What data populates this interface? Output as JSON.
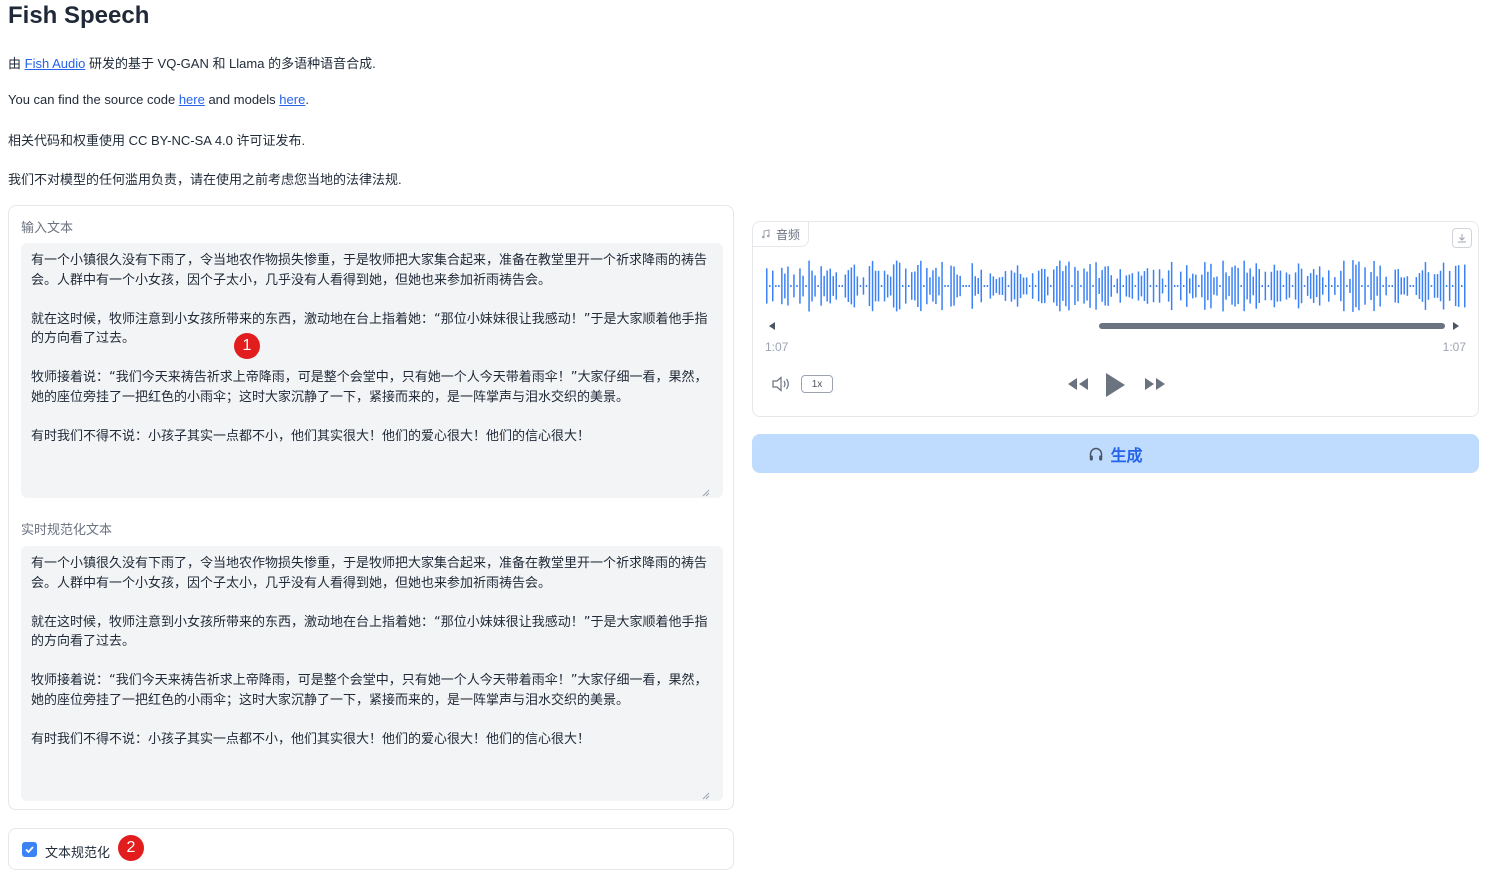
{
  "header": {
    "title": "Fish Speech",
    "line1": {
      "prefix": "由 ",
      "link": "Fish Audio",
      "suffix": " 研发的基于 VQ-GAN 和 Llama 的多语种语音合成."
    },
    "line2": {
      "a": "You can find the source code ",
      "link1": "here",
      "b": " and models ",
      "link2": "here",
      "c": "."
    },
    "line3": "相关代码和权重使用 CC BY-NC-SA 4.0 许可证发布.",
    "line4": "我们不对模型的任何滥用负责，请在使用之前考虑您当地的法律法规."
  },
  "input": {
    "label": "输入文本",
    "text": "有一个小镇很久没有下雨了，令当地农作物损失惨重，于是牧师把大家集合起来，准备在教堂里开一个祈求降雨的祷告会。人群中有一个小女孩，因个子太小，几乎没有人看得到她，但她也来参加祈雨祷告会。\n\n就在这时候，牧师注意到小女孩所带来的东西，激动地在台上指着她：“那位小妹妹很让我感动！”于是大家顺着他手指的方向看了过去。\n\n牧师接着说：“我们今天来祷告祈求上帝降雨，可是整个会堂中，只有她一个人今天带着雨伞！”大家仔细一看，果然，她的座位旁挂了一把红色的小雨伞；这时大家沉静了一下，紧接而来的，是一阵掌声与泪水交织的美景。\n\n有时我们不得不说：小孩子其实一点都不小，他们其实很大！他们的爱心很大！他们的信心很大！"
  },
  "normalized": {
    "label": "实时规范化文本",
    "text": "有一个小镇很久没有下雨了，令当地农作物损失惨重，于是牧师把大家集合起来，准备在教堂里开一个祈求降雨的祷告会。人群中有一个小女孩，因个子太小，几乎没有人看得到她，但她也来参加祈雨祷告会。\n\n就在这时候，牧师注意到小女孩所带来的东西，激动地在台上指着她：“那位小妹妹很让我感动！”于是大家顺着他手指的方向看了过去。\n\n牧师接着说：“我们今天来祷告祈求上帝降雨，可是整个会堂中，只有她一个人今天带着雨伞！”大家仔细一看，果然，她的座位旁挂了一把红色的小雨伞；这时大家沉静了一下，紧接而来的，是一阵掌声与泪水交织的美景。\n\n有时我们不得不说：小孩子其实一点都不小，他们其实很大！他们的爱心很大！他们的信心很大！"
  },
  "checkbox": {
    "label": "文本规范化",
    "checked": true
  },
  "markers": [
    "1",
    "2"
  ],
  "audio": {
    "label": "音频",
    "current_time": "1:07",
    "duration": "1:07",
    "rate": "1x",
    "icons": [
      "music-icon",
      "download-icon",
      "volume-icon",
      "rewind-icon",
      "play-icon",
      "fast-forward-icon"
    ],
    "progress": 1.0
  },
  "generate": {
    "label": "生成",
    "icon": "headphones-icon"
  },
  "colors": {
    "accent": "#3b82f6",
    "button_bg": "#bfdbfe",
    "button_text": "#2563eb",
    "marker": "#e11d1d"
  }
}
